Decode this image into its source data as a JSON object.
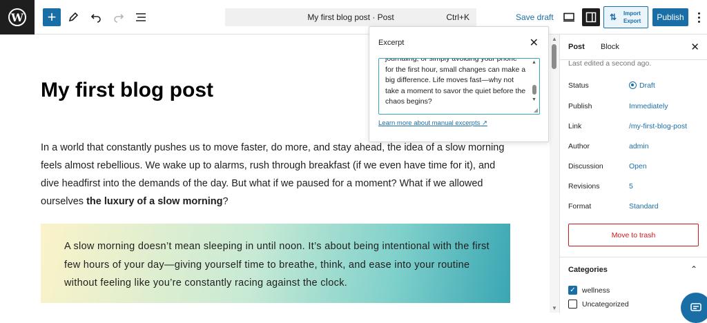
{
  "topbar": {
    "command_title": "My first blog post · Post",
    "command_shortcut": "Ctrl+K",
    "save_draft": "Save draft",
    "import_line1": "Import",
    "import_line2": "Export",
    "publish": "Publish",
    "icons": [
      "wordpress-logo",
      "plus",
      "pencil",
      "undo",
      "redo",
      "list-view",
      "desktop-preview",
      "sidebar-settings",
      "import-export",
      "more-vertical"
    ]
  },
  "editor": {
    "title": "My first blog post",
    "paragraph_text": "In a world that constantly pushes us to move faster, do more, and stay ahead, the idea of a slow morning feels almost rebellious. We wake up to alarms, rush through breakfast (if we even have time for it), and dive headfirst into the demands of the day. But what if we paused for a moment? What if we allowed ourselves ",
    "paragraph_bold": "the luxury of a slow morning",
    "paragraph_end": "?",
    "quote": "A slow morning doesn’t mean sleeping in until noon. It’s about being intentional with the first few hours of your day—giving yourself time to breathe, think, and ease into your routine without feeling like you’re constantly racing against the clock."
  },
  "excerpt_popover": {
    "title": "Excerpt",
    "text": "journaling, or simply avoiding your phone for the first hour, small changes can make a big difference. Life moves fast—why not take a moment to savor the quiet before the chaos begins?",
    "learn_more": "Learn more about manual excerpts ↗"
  },
  "sidebar": {
    "tabs": [
      "Post",
      "Block"
    ],
    "last_edited": "Last edited a second ago.",
    "rows": [
      {
        "label": "Status",
        "value": "Draft"
      },
      {
        "label": "Publish",
        "value": "Immediately"
      },
      {
        "label": "Link",
        "value": "/my-first-blog-post"
      },
      {
        "label": "Author",
        "value": "admin"
      },
      {
        "label": "Discussion",
        "value": "Open"
      },
      {
        "label": "Revisions",
        "value": "5"
      },
      {
        "label": "Format",
        "value": "Standard"
      }
    ],
    "move_to_trash": "Move to trash",
    "categories_title": "Categories",
    "categories": [
      {
        "name": "wellness",
        "checked": true
      },
      {
        "name": "Uncategorized",
        "checked": false
      }
    ]
  },
  "colors": {
    "accent": "#1a6ea6",
    "danger": "#cc1818",
    "dark": "#1e1e1e"
  }
}
